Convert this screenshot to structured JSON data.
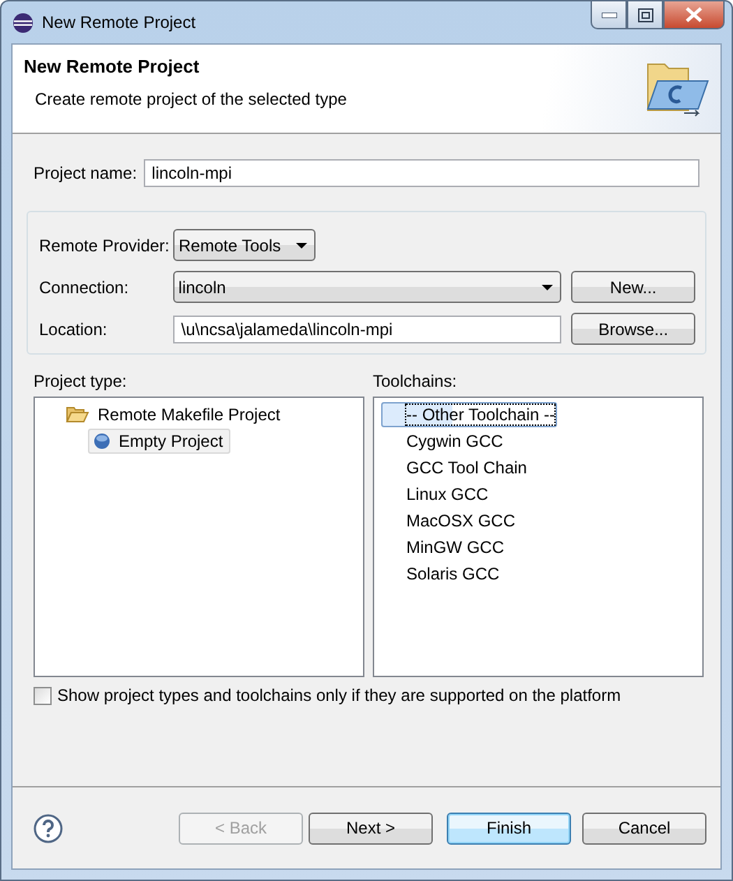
{
  "window": {
    "title": "New Remote Project"
  },
  "header": {
    "title": "New Remote Project",
    "description": "Create remote project of the selected type"
  },
  "project_name": {
    "label": "Project name:",
    "value": "lincoln-mpi"
  },
  "remote": {
    "provider": {
      "label": "Remote Provider:",
      "value": "Remote Tools"
    },
    "connection": {
      "label": "Connection:",
      "value": "lincoln",
      "button": "New..."
    },
    "location": {
      "label": "Location:",
      "value": "\\u\\ncsa\\jalameda\\lincoln-mpi",
      "button": "Browse..."
    }
  },
  "project_type": {
    "label": "Project type:",
    "items": [
      {
        "label": "Remote Makefile Project",
        "kind": "folder",
        "selected": false,
        "expanded": true,
        "children": [
          {
            "label": "Empty Project",
            "kind": "project",
            "selected": true
          }
        ]
      }
    ]
  },
  "toolchains": {
    "label": "Toolchains:",
    "items": [
      {
        "label": "-- Other Toolchain --",
        "selected": true
      },
      {
        "label": "Cygwin GCC",
        "selected": false
      },
      {
        "label": "GCC Tool Chain",
        "selected": false
      },
      {
        "label": "Linux GCC",
        "selected": false
      },
      {
        "label": "MacOSX GCC",
        "selected": false
      },
      {
        "label": "MinGW GCC",
        "selected": false
      },
      {
        "label": "Solaris GCC",
        "selected": false
      }
    ]
  },
  "filter": {
    "label": "Show project types and toolchains only if they are supported on the platform",
    "checked": false
  },
  "buttons": [
    {
      "label": "< Back",
      "disabled": true,
      "default": false
    },
    {
      "label": "Next >",
      "disabled": false,
      "default": false
    },
    {
      "label": "Finish",
      "disabled": false,
      "default": true
    },
    {
      "label": "Cancel",
      "disabled": false,
      "default": false
    }
  ]
}
